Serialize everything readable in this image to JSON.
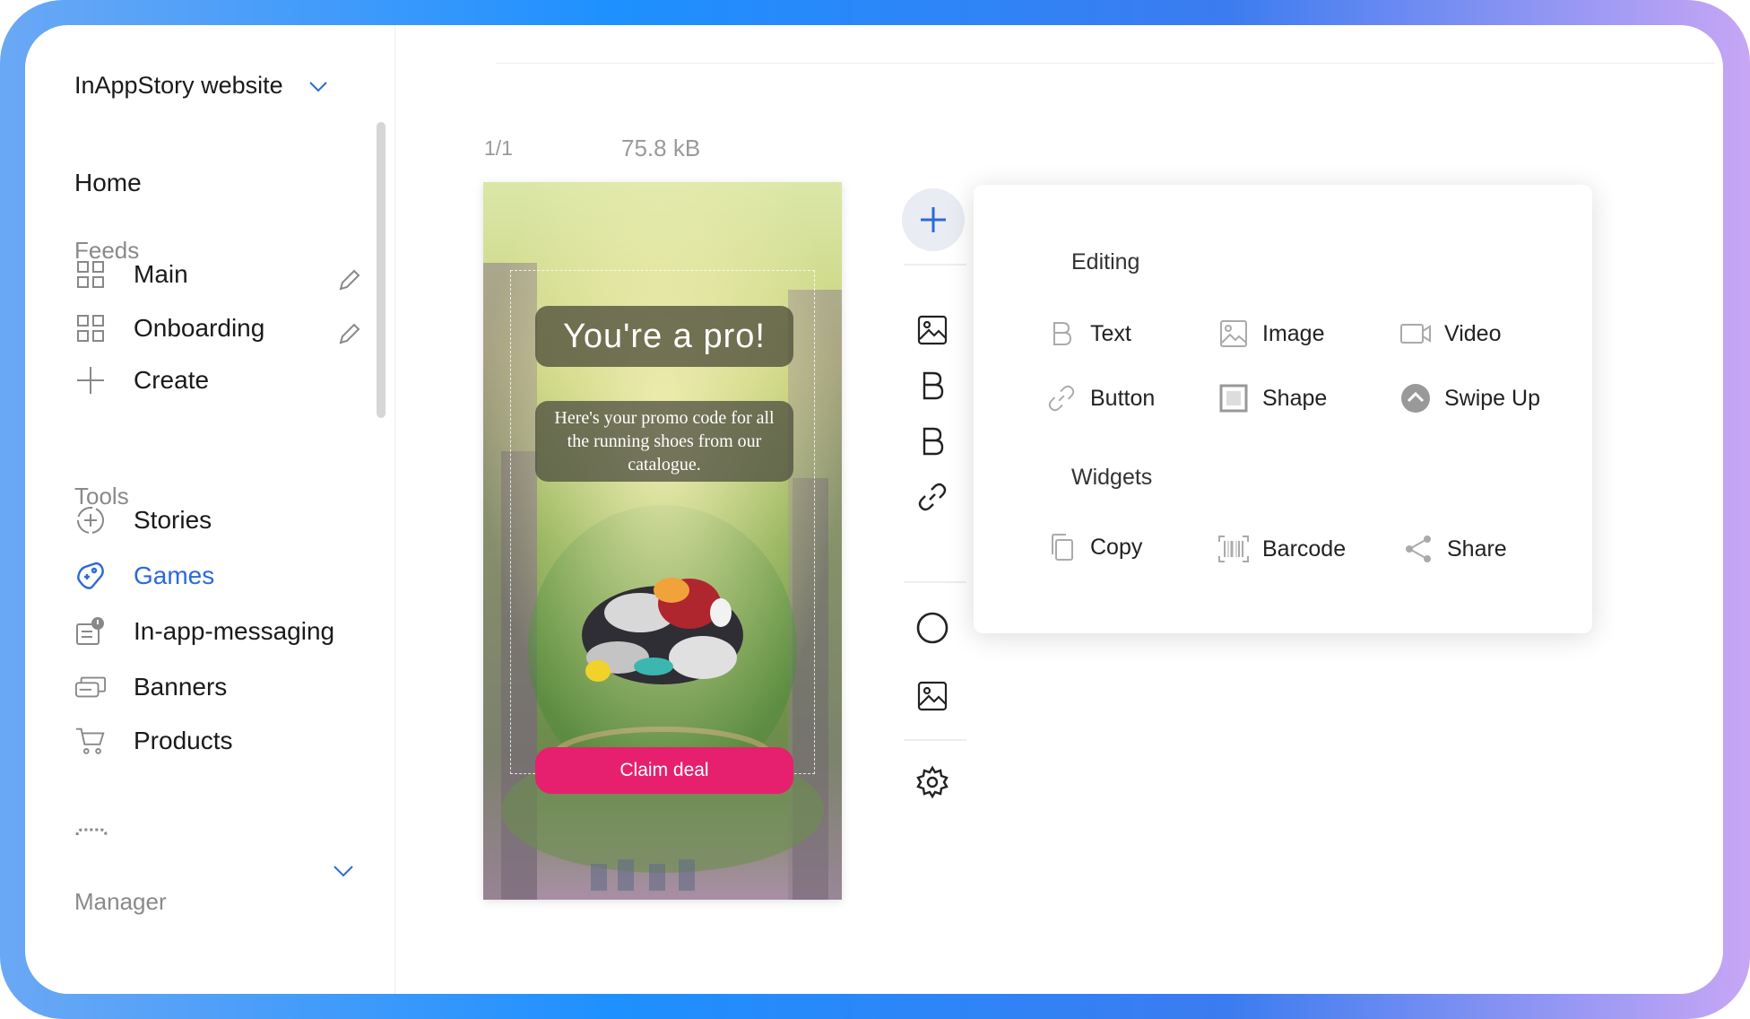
{
  "sidebar": {
    "project_name": "InAppStory website",
    "home": "Home",
    "feeds_heading": "Feeds",
    "feeds": [
      {
        "label": "Main",
        "icon": "grid-icon"
      },
      {
        "label": "Onboarding",
        "icon": "grid-icon"
      },
      {
        "label": "Create",
        "icon": "plus-icon"
      }
    ],
    "tools_heading": "Tools",
    "tools": [
      {
        "label": "Stories",
        "icon": "stories-icon"
      },
      {
        "label": "Games",
        "icon": "gamepad-icon",
        "active": true
      },
      {
        "label": "In-app-messaging",
        "icon": "message-icon"
      },
      {
        "label": "Banners",
        "icon": "banners-icon"
      },
      {
        "label": "Products",
        "icon": "cart-icon"
      }
    ],
    "manager_heading": "Manager"
  },
  "editor": {
    "slide_counter": "1/1",
    "file_size": "75.8 kB"
  },
  "story": {
    "title": "You're a pro!",
    "description": "Here's your promo code for all the running shoes from our catalogue.",
    "cta": "Claim deal"
  },
  "popup": {
    "editing_heading": "Editing",
    "editing_items": [
      {
        "label": "Text",
        "icon": "text-icon"
      },
      {
        "label": "Image",
        "icon": "image-icon"
      },
      {
        "label": "Video",
        "icon": "video-icon"
      },
      {
        "label": "Button",
        "icon": "link-icon"
      },
      {
        "label": "Shape",
        "icon": "shape-icon"
      },
      {
        "label": "Swipe Up",
        "icon": "swipe-up-icon"
      }
    ],
    "widgets_heading": "Widgets",
    "widget_items": [
      {
        "label": "Copy",
        "icon": "copy-icon"
      },
      {
        "label": "Barcode",
        "icon": "barcode-icon"
      },
      {
        "label": "Share",
        "icon": "share-icon"
      }
    ]
  },
  "colors": {
    "accent": "#2a6ad9",
    "cta": "#e6206e",
    "frame_gradient": [
      "#6aa8f5",
      "#1e90ff",
      "#c7a6f5"
    ]
  }
}
